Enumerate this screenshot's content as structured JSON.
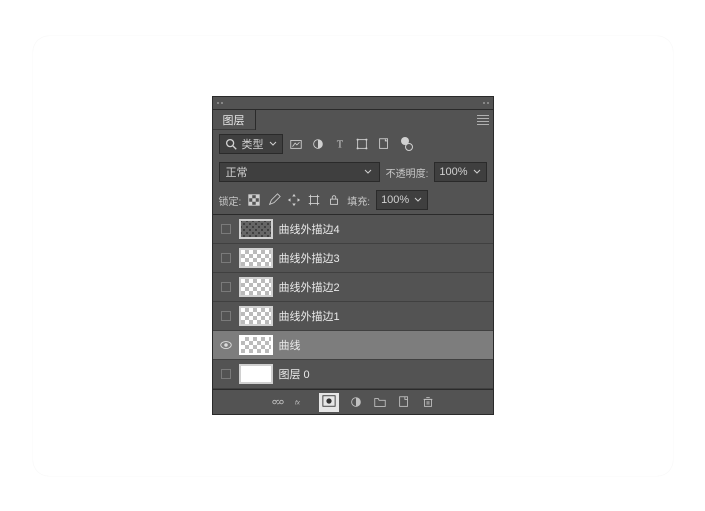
{
  "tab_label": "图层",
  "filter": {
    "search_icon": "search",
    "label": "类型"
  },
  "blend_mode": "正常",
  "opacity": {
    "label": "不透明度:",
    "value": "100%"
  },
  "lock": {
    "label": "锁定:",
    "fill_label": "填充:",
    "value": "100%"
  },
  "layers": [
    {
      "name": "曲线外描边4",
      "visible": false,
      "selected": false,
      "thumb": "dotrow"
    },
    {
      "name": "曲线外描边3",
      "visible": false,
      "selected": false,
      "thumb": "checker"
    },
    {
      "name": "曲线外描边2",
      "visible": false,
      "selected": false,
      "thumb": "checker"
    },
    {
      "name": "曲线外描边1",
      "visible": false,
      "selected": false,
      "thumb": "checker"
    },
    {
      "name": "曲线",
      "visible": true,
      "selected": true,
      "thumb": "checker"
    },
    {
      "name": "图层 0",
      "visible": false,
      "selected": false,
      "thumb": "white"
    }
  ]
}
